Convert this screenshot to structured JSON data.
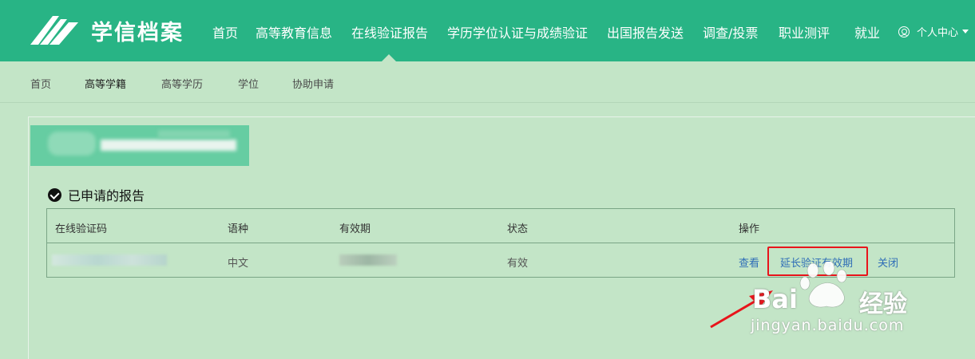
{
  "header": {
    "logo_text": "学信档案",
    "nav": [
      "首页",
      "高等教育信息",
      "在线验证报告",
      "学历学位认证与成绩验证",
      "出国报告发送",
      "调查/投票",
      "职业测评",
      "就业"
    ],
    "user_menu_label": "个人中心"
  },
  "subnav": {
    "items": [
      "首页",
      "高等学籍",
      "高等学历",
      "学位",
      "协助申请"
    ],
    "active": "高等学籍"
  },
  "section": {
    "title": "已申请的报告"
  },
  "table": {
    "headers": [
      "在线验证码",
      "语种",
      "有效期",
      "状态",
      "操作"
    ],
    "rows": [
      {
        "code": "",
        "language": "中文",
        "expiry": "",
        "status": "有效",
        "actions": [
          "查看",
          "延长验证有效期",
          "关闭"
        ]
      }
    ]
  },
  "watermark": {
    "brand": "Bai",
    "brand_cn": "经验",
    "url": "jingyan.baidu.com"
  },
  "colors": {
    "primary": "#28b485",
    "background": "#c3e5c7",
    "link": "#2e6db7",
    "highlight": "#e8141b"
  }
}
